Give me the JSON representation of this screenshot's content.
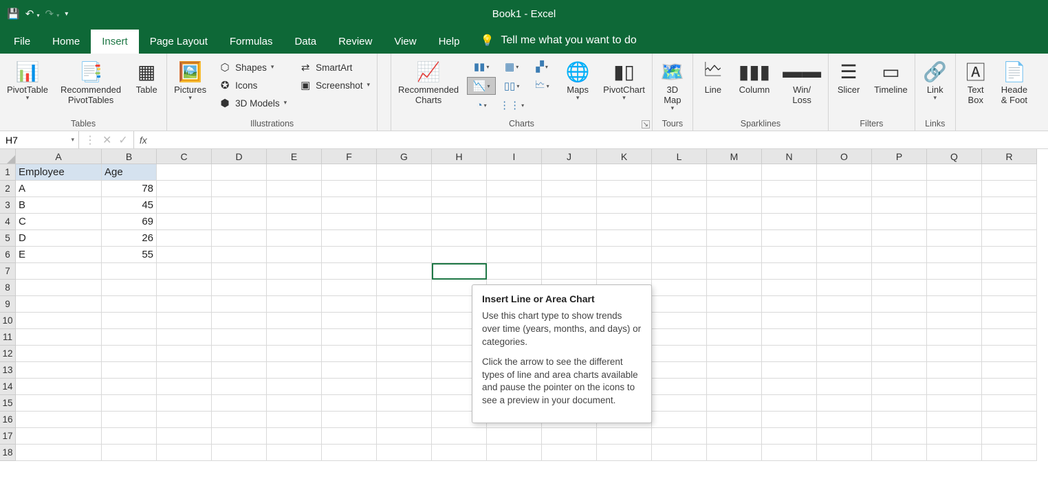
{
  "title": "Book1  -  Excel",
  "tabs": [
    "File",
    "Home",
    "Insert",
    "Page Layout",
    "Formulas",
    "Data",
    "Review",
    "View",
    "Help"
  ],
  "active_tab": "Insert",
  "tellme": "Tell me what you want to do",
  "ribbon": {
    "tables": {
      "label": "Tables",
      "pivot": "PivotTable",
      "recpivot": "Recommended\nPivotTables",
      "table": "Table"
    },
    "illus": {
      "label": "Illustrations",
      "pictures": "Pictures",
      "shapes": "Shapes",
      "icons": "Icons",
      "models": "3D Models",
      "smartart": "SmartArt",
      "screenshot": "Screenshot"
    },
    "charts": {
      "label": "Charts",
      "rec": "Recommended\nCharts",
      "maps": "Maps",
      "pivotchart": "PivotChart"
    },
    "tours": {
      "label": "Tours",
      "map": "3D\nMap"
    },
    "spark": {
      "label": "Sparklines",
      "line": "Line",
      "column": "Column",
      "winloss": "Win/\nLoss"
    },
    "filters": {
      "label": "Filters",
      "slicer": "Slicer",
      "timeline": "Timeline"
    },
    "links": {
      "label": "Links",
      "link": "Link"
    },
    "text": {
      "textbox": "Text\nBox",
      "header": "Heade\n& Foot"
    }
  },
  "namebox": "H7",
  "tooltip": {
    "title": "Insert Line or Area Chart",
    "p1": "Use this chart type to show trends over time (years, months, and days) or categories.",
    "p2": "Click the arrow to see the different types of line and area charts available and pause the pointer on the icons to see a preview in your document."
  },
  "columns": [
    "A",
    "B",
    "C",
    "D",
    "E",
    "F",
    "G",
    "H",
    "I",
    "J",
    "K",
    "L",
    "M",
    "N",
    "O",
    "P",
    "Q",
    "R"
  ],
  "sheet": {
    "headers": [
      "Employee",
      "Age"
    ],
    "rows": [
      [
        "A",
        "78"
      ],
      [
        "B",
        "45"
      ],
      [
        "C",
        "69"
      ],
      [
        "D",
        "26"
      ],
      [
        "E",
        "55"
      ]
    ]
  },
  "chart_data": {
    "type": "table",
    "columns": [
      "Employee",
      "Age"
    ],
    "rows": [
      [
        "A",
        78
      ],
      [
        "B",
        45
      ],
      [
        "C",
        69
      ],
      [
        "D",
        26
      ],
      [
        "E",
        55
      ]
    ]
  }
}
